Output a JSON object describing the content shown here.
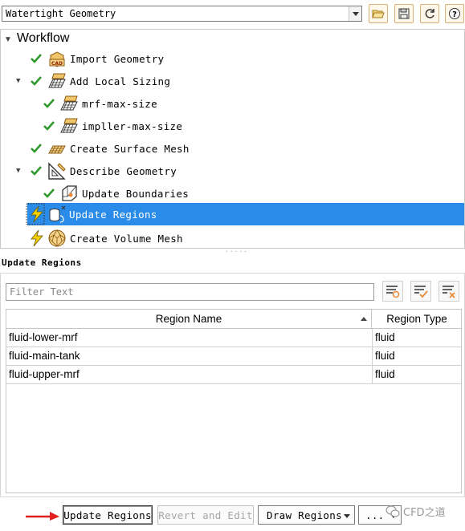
{
  "toolbar": {
    "workflow_value": "Watertight Geometry",
    "buttons": [
      "open-folder-icon",
      "save-icon",
      "refresh-icon",
      "help-icon"
    ]
  },
  "tree": {
    "title": "Workflow",
    "items": [
      {
        "label": "Import Geometry",
        "status": "done",
        "icon": "cad-import-icon"
      },
      {
        "label": "Add Local Sizing",
        "status": "done",
        "icon": "mesh-grid-icon",
        "expanded": true
      },
      {
        "label": "mrf-max-size",
        "status": "done",
        "icon": "mesh-grid-icon"
      },
      {
        "label": "impller-max-size",
        "status": "done",
        "icon": "mesh-grid-icon"
      },
      {
        "label": "Create Surface Mesh",
        "status": "done",
        "icon": "surface-mesh-icon"
      },
      {
        "label": "Describe Geometry",
        "status": "done",
        "icon": "set-square-icon",
        "expanded": true
      },
      {
        "label": "Update Boundaries",
        "status": "done",
        "icon": "boundary-icon"
      },
      {
        "label": "Update Regions",
        "status": "pending",
        "icon": "regions-icon",
        "selected": true
      },
      {
        "label": "Create Volume Mesh",
        "status": "pending",
        "icon": "volume-mesh-icon"
      }
    ]
  },
  "panel": {
    "title": "Update Regions",
    "filter_placeholder": "Filter Text",
    "columns": [
      "Region Name",
      "Region Type"
    ],
    "rows": [
      {
        "name": "fluid-lower-mrf",
        "type": "fluid"
      },
      {
        "name": "fluid-main-tank",
        "type": "fluid"
      },
      {
        "name": "fluid-upper-mrf",
        "type": "fluid"
      }
    ]
  },
  "actions": {
    "update": "Update Regions",
    "revert": "Revert and Edit",
    "draw": "Draw Regions",
    "more": "..."
  },
  "watermark": "CFD之道",
  "colors": {
    "accent": "#2a8ce8",
    "check": "#2e9a2e",
    "pending": "#f0c000",
    "arrow": "#e0201e"
  }
}
